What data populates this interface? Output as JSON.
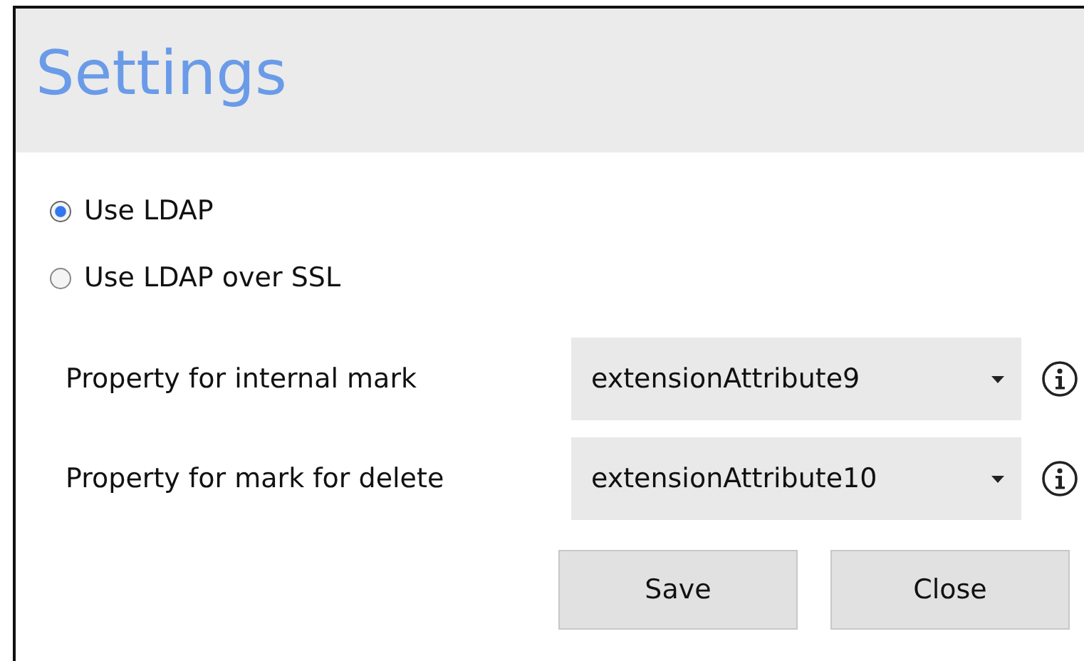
{
  "window": {
    "title": "Settings"
  },
  "radios": [
    {
      "label": "Use LDAP",
      "selected": true
    },
    {
      "label": "Use LDAP over SSL",
      "selected": false
    }
  ],
  "properties": [
    {
      "label": "Property for internal mark",
      "value": "extensionAttribute9"
    },
    {
      "label": "Property for mark for delete",
      "value": "extensionAttribute10"
    }
  ],
  "buttons": [
    "Save",
    "Close"
  ]
}
